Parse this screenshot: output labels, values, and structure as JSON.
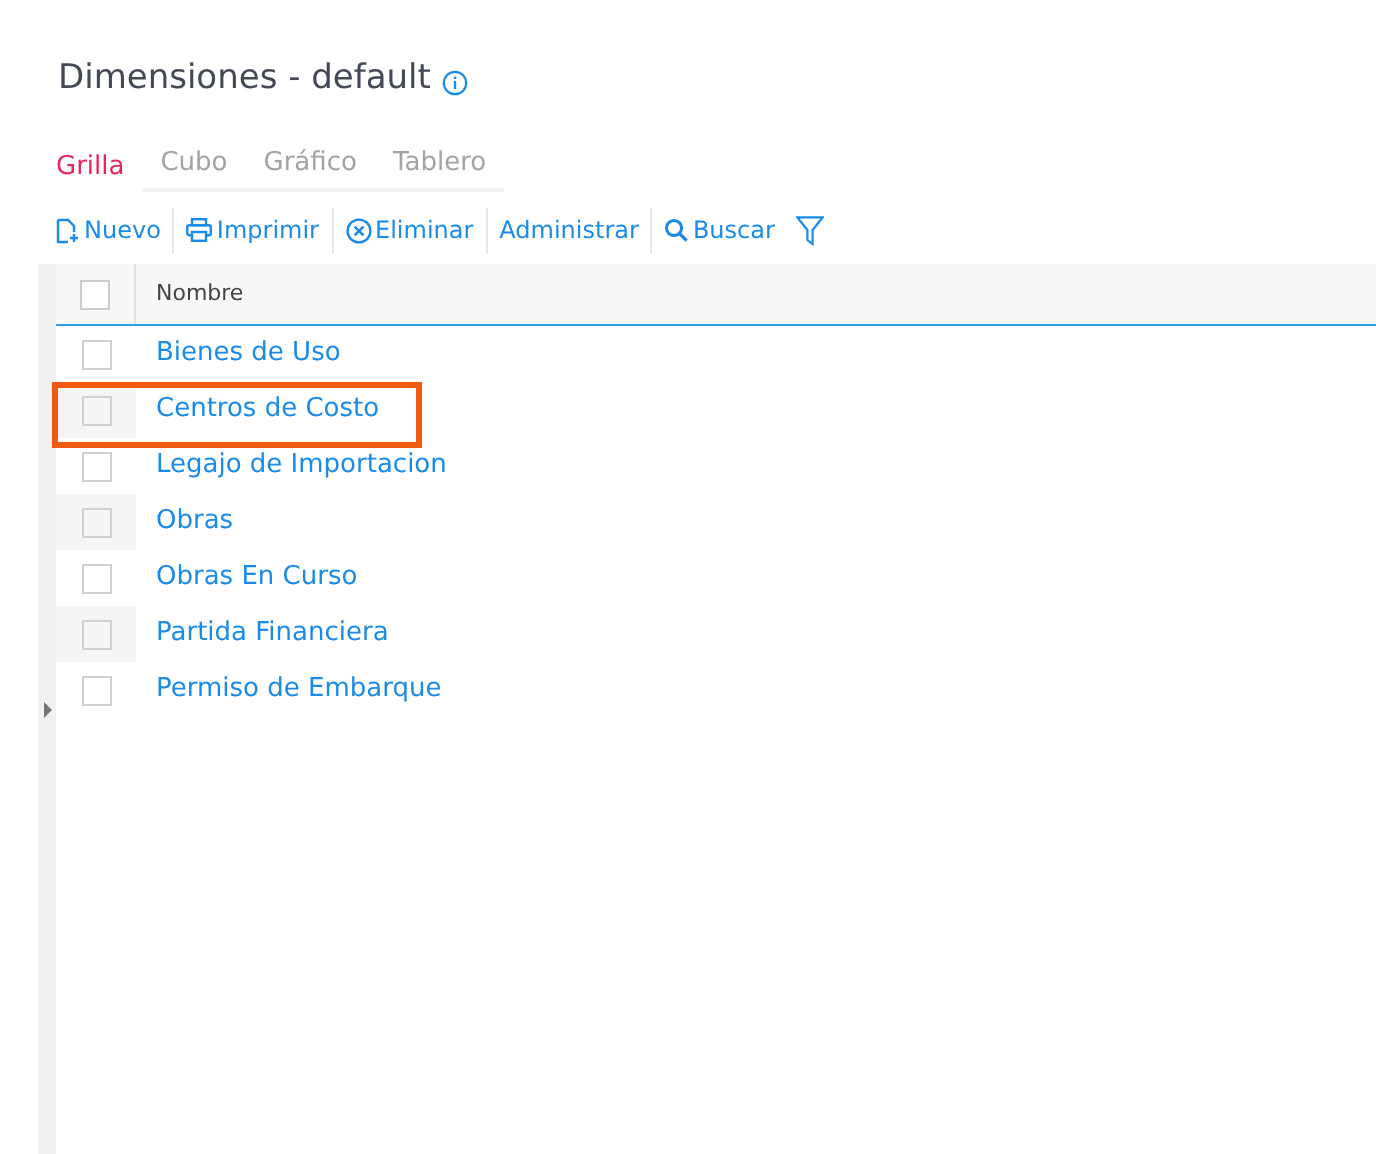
{
  "title": "Dimensiones - default",
  "tabs": [
    {
      "label": "Grilla",
      "selected": true
    },
    {
      "label": "Cubo",
      "selected": false
    },
    {
      "label": "Gráfico",
      "selected": false
    },
    {
      "label": "Tablero",
      "selected": false
    }
  ],
  "toolbar": [
    {
      "kind": "new",
      "label": "Nuevo"
    },
    {
      "kind": "print",
      "label": "Imprimir"
    },
    {
      "kind": "delete",
      "label": "Eliminar"
    },
    {
      "kind": "plain",
      "label": "Administrar"
    },
    {
      "kind": "search",
      "label": "Buscar"
    },
    {
      "kind": "filter"
    }
  ],
  "table": {
    "all_checked": false,
    "columns": [
      "Nombre"
    ],
    "rows": [
      {
        "name": "Bienes de Uso",
        "checked": false,
        "highlighted": false
      },
      {
        "name": "Centros de Costo",
        "checked": false,
        "highlighted": true
      },
      {
        "name": "Legajo de Importacion",
        "checked": false,
        "highlighted": false
      },
      {
        "name": "Obras",
        "checked": false,
        "highlighted": false
      },
      {
        "name": "Obras En Curso",
        "checked": false,
        "highlighted": false
      },
      {
        "name": "Partida Financiera",
        "checked": false,
        "highlighted": false
      },
      {
        "name": "Permiso de Embarque",
        "checked": false,
        "highlighted": false
      }
    ]
  }
}
